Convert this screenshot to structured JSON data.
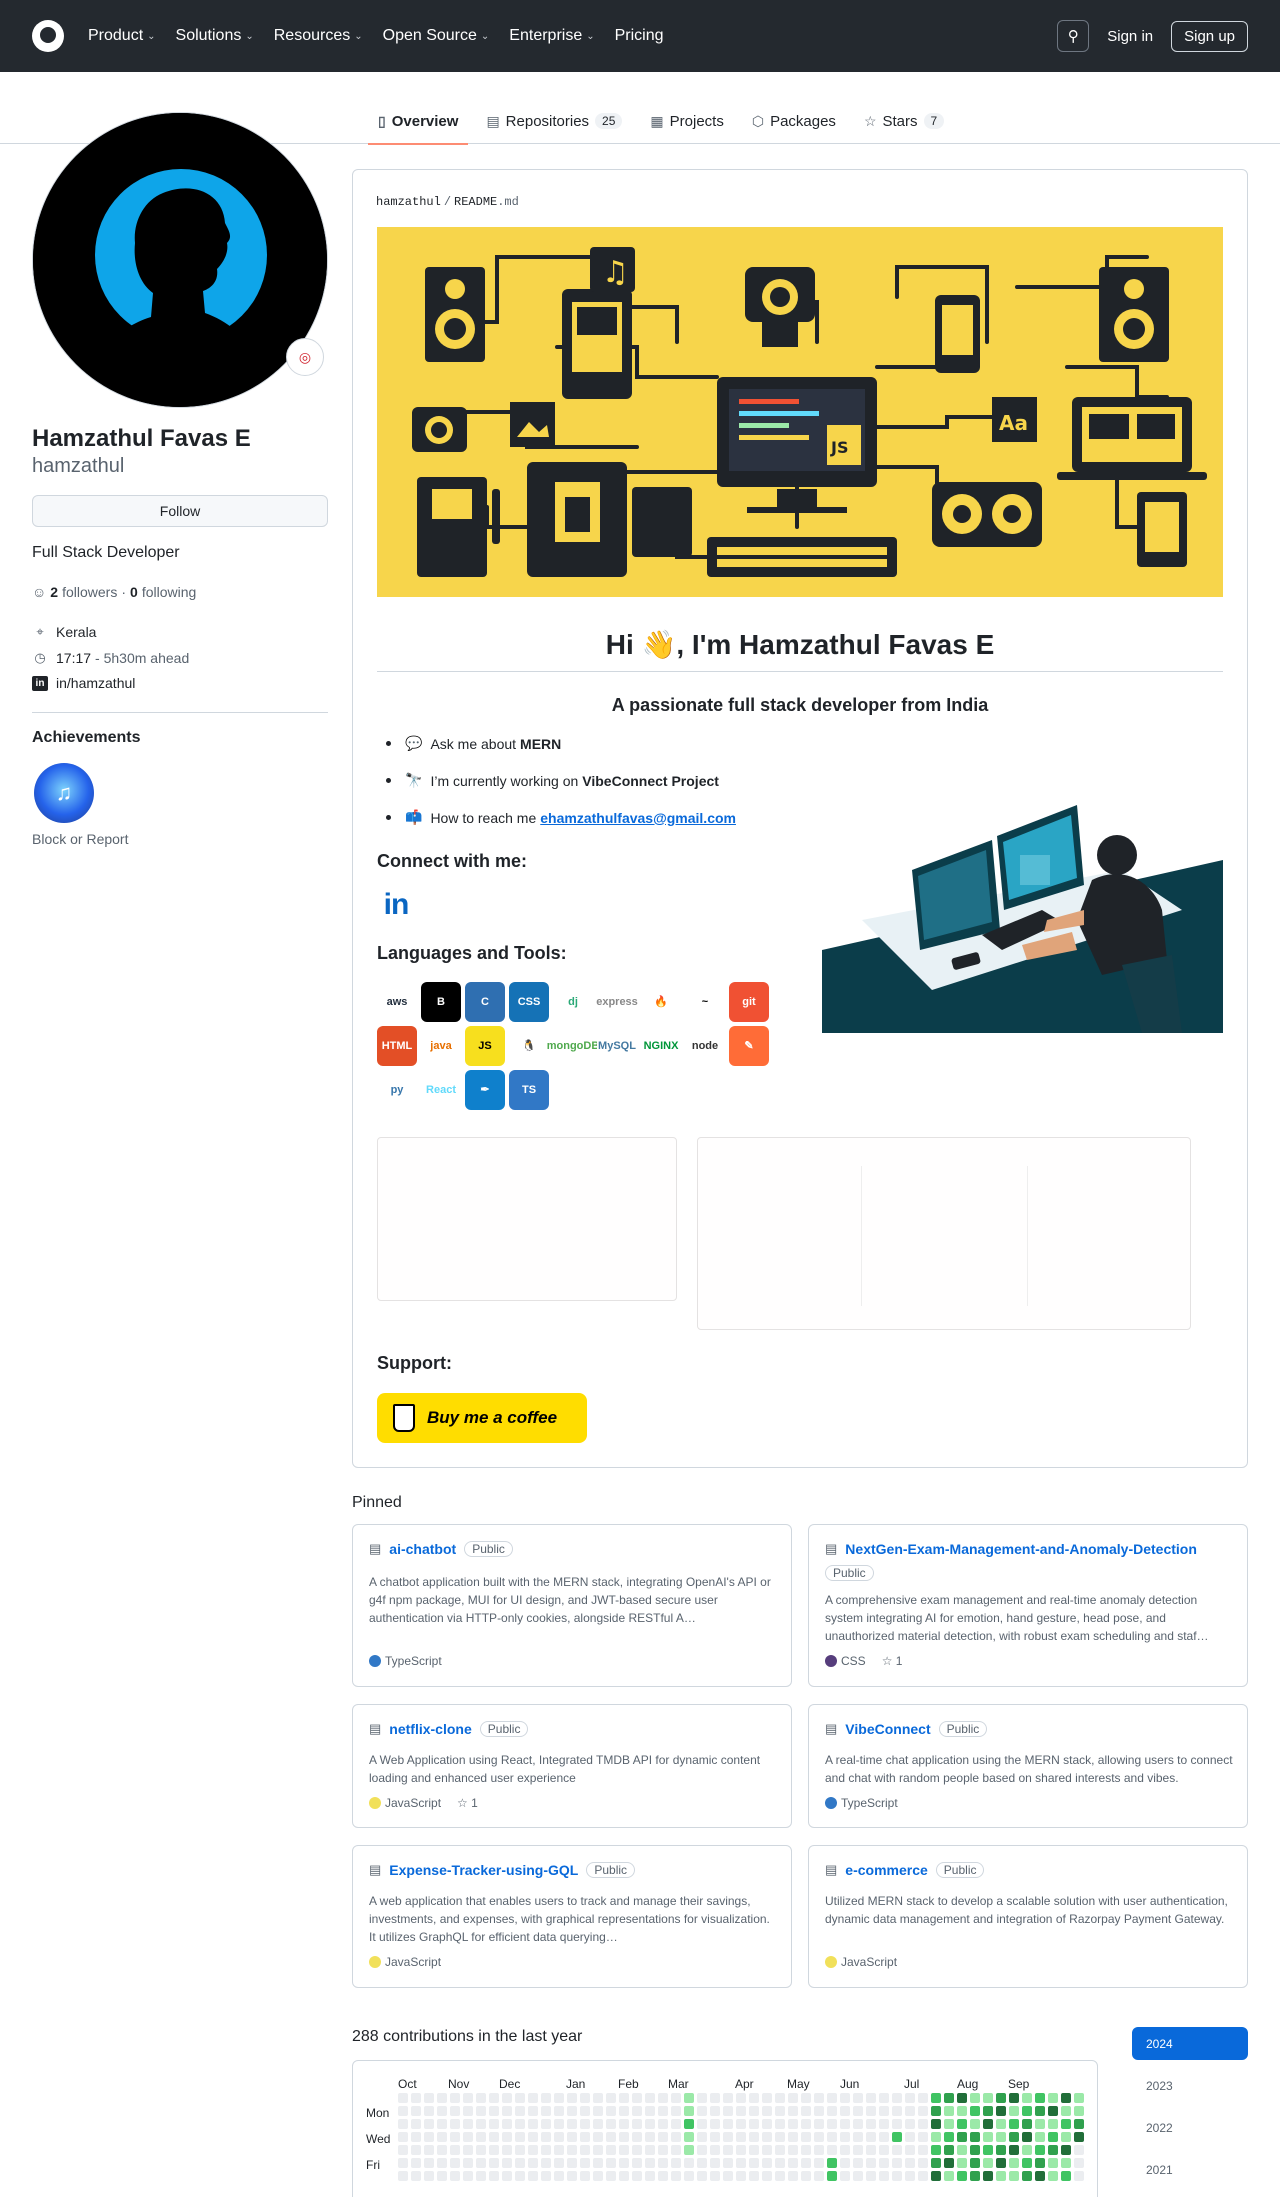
{
  "header": {
    "nav": [
      {
        "label": "Product",
        "has_menu": true
      },
      {
        "label": "Solutions",
        "has_menu": true
      },
      {
        "label": "Resources",
        "has_menu": true
      },
      {
        "label": "Open Source",
        "has_menu": true
      },
      {
        "label": "Enterprise",
        "has_menu": true
      },
      {
        "label": "Pricing",
        "has_menu": false
      }
    ],
    "sign_in": "Sign in",
    "sign_up": "Sign up"
  },
  "tabs": [
    {
      "label": "Overview",
      "icon": "book-icon",
      "count": null,
      "active": true
    },
    {
      "label": "Repositories",
      "icon": "repo-icon",
      "count": "25",
      "active": false
    },
    {
      "label": "Projects",
      "icon": "table-icon",
      "count": null,
      "active": false
    },
    {
      "label": "Packages",
      "icon": "package-icon",
      "count": null,
      "active": false
    },
    {
      "label": "Stars",
      "icon": "star-icon",
      "count": "7",
      "active": false
    }
  ],
  "profile": {
    "name": "Hamzathul Favas E",
    "login": "hamzathul",
    "follow_label": "Follow",
    "bio": "Full Stack Developer",
    "followers_count": "2",
    "followers_label": "followers",
    "separator": "·",
    "following_count": "0",
    "following_label": "following",
    "location": "Kerala",
    "local_time": "17:17",
    "time_offset": "- 5h30m ahead",
    "social": "in/hamzathul",
    "achievements_title": "Achievements",
    "block_label": "Block or Report"
  },
  "readme": {
    "path_user": "hamzathul",
    "path_sep": "/",
    "path_file_name": "README",
    "path_file_ext": ".md",
    "greeting": "Hi 👋, I'm Hamzathul Favas E",
    "subtitle": "A passionate full stack developer from India",
    "bullets": [
      {
        "emoji": "💬",
        "text": "Ask me about",
        "strong": "MERN"
      },
      {
        "emoji": "🔭",
        "text": "I’m currently working on",
        "strong": "VibeConnect Project"
      },
      {
        "emoji": "📫",
        "text": "How to reach me",
        "link": "ehamzathulfavas@gmail.com"
      }
    ],
    "connect_heading": "Connect with me:",
    "linkedin_glyph": "in",
    "languages_heading": "Languages and Tools:",
    "tools": [
      {
        "name": "aws",
        "bg": "#ffffff",
        "fg": "#232f3e"
      },
      {
        "name": "B",
        "bg": "#000000",
        "fg": "#ffffff"
      },
      {
        "name": "C",
        "bg": "#2f6fb1",
        "fg": "#ffffff"
      },
      {
        "name": "CSS",
        "bg": "#1572b6",
        "fg": "#ffffff"
      },
      {
        "name": "dj",
        "bg": "#ffffff",
        "fg": "#2ba977"
      },
      {
        "name": "express",
        "bg": "#ffffff",
        "fg": "#888888"
      },
      {
        "name": "🔥",
        "bg": "#ffffff",
        "fg": "#f5a623"
      },
      {
        "name": "~",
        "bg": "#ffffff",
        "fg": "#000000"
      },
      {
        "name": "git",
        "bg": "#f05133",
        "fg": "#ffffff"
      },
      {
        "name": "HTML",
        "bg": "#e34f26",
        "fg": "#ffffff"
      },
      {
        "name": "java",
        "bg": "#ffffff",
        "fg": "#e76f00"
      },
      {
        "name": "JS",
        "bg": "#f7df1e",
        "fg": "#000000"
      },
      {
        "name": "🐧",
        "bg": "#ffffff",
        "fg": "#000000"
      },
      {
        "name": "mongoDB",
        "bg": "#ffffff",
        "fg": "#4fa94d"
      },
      {
        "name": "MySQL",
        "bg": "#ffffff",
        "fg": "#4479a1"
      },
      {
        "name": "NGINX",
        "bg": "#ffffff",
        "fg": "#009639"
      },
      {
        "name": "node",
        "bg": "#ffffff",
        "fg": "#333333"
      },
      {
        "name": "✎",
        "bg": "#ff6c37",
        "fg": "#ffffff"
      },
      {
        "name": "py",
        "bg": "#ffffff",
        "fg": "#3776ab"
      },
      {
        "name": "React",
        "bg": "#ffffff",
        "fg": "#61dafb"
      },
      {
        "name": "✒",
        "bg": "#0f80cc",
        "fg": "#ffffff"
      },
      {
        "name": "TS",
        "bg": "#3178c6",
        "fg": "#ffffff"
      }
    ],
    "support_heading": "Support:",
    "coffee_label": "Buy me a coffee"
  },
  "pinned": {
    "title": "Pinned",
    "repos": [
      {
        "name": "ai-chatbot",
        "visibility": "Public",
        "desc": "A chatbot application built with the MERN stack, integrating OpenAI's API or g4f npm package, MUI for UI design, and JWT-based secure user authentication via HTTP-only cookies, alongside RESTful A…",
        "lang": "TypeScript",
        "lang_color": "#3178c6",
        "stars": ""
      },
      {
        "name": "NextGen-Exam-Management-and-Anomaly-Detection",
        "visibility": "Public",
        "desc": "A comprehensive exam management and real-time anomaly detection system integrating AI for emotion, hand gesture, head pose, and unauthorized material detection, with robust exam scheduling and staf…",
        "lang": "CSS",
        "lang_color": "#563d7c",
        "stars": "1"
      },
      {
        "name": "netflix-clone",
        "visibility": "Public",
        "desc": "A Web Application using React, Integrated TMDB API for dynamic content loading and enhanced user experience",
        "lang": "JavaScript",
        "lang_color": "#f1e05a",
        "stars": "1"
      },
      {
        "name": "VibeConnect",
        "visibility": "Public",
        "desc": "A real-time chat application using the MERN stack, allowing users to connect and chat with random people based on shared interests and vibes.",
        "lang": "TypeScript",
        "lang_color": "#3178c6",
        "stars": ""
      },
      {
        "name": "Expense-Tracker-using-GQL",
        "visibility": "Public",
        "desc": "A web application that enables users to track and manage their savings, investments, and expenses, with graphical representations for visualization. It utilizes GraphQL for efficient data querying…",
        "lang": "JavaScript",
        "lang_color": "#f1e05a",
        "stars": ""
      },
      {
        "name": "e-commerce",
        "visibility": "Public",
        "desc": "Utilized MERN stack to develop a scalable solution with user authentication, dynamic data management and integration of Razorpay Payment Gateway.",
        "lang": "JavaScript",
        "lang_color": "#f1e05a",
        "stars": ""
      }
    ]
  },
  "contributions": {
    "title": "288 contributions in the last year",
    "months": [
      "Oct",
      "Nov",
      "Dec",
      "Jan",
      "Feb",
      "Mar",
      "Apr",
      "May",
      "Jun",
      "Jul",
      "Aug",
      "Sep"
    ],
    "days": [
      "Mon",
      "Wed",
      "Fri"
    ],
    "years": [
      "2024",
      "2023",
      "2022",
      "2021"
    ],
    "selected_year": "2024"
  }
}
